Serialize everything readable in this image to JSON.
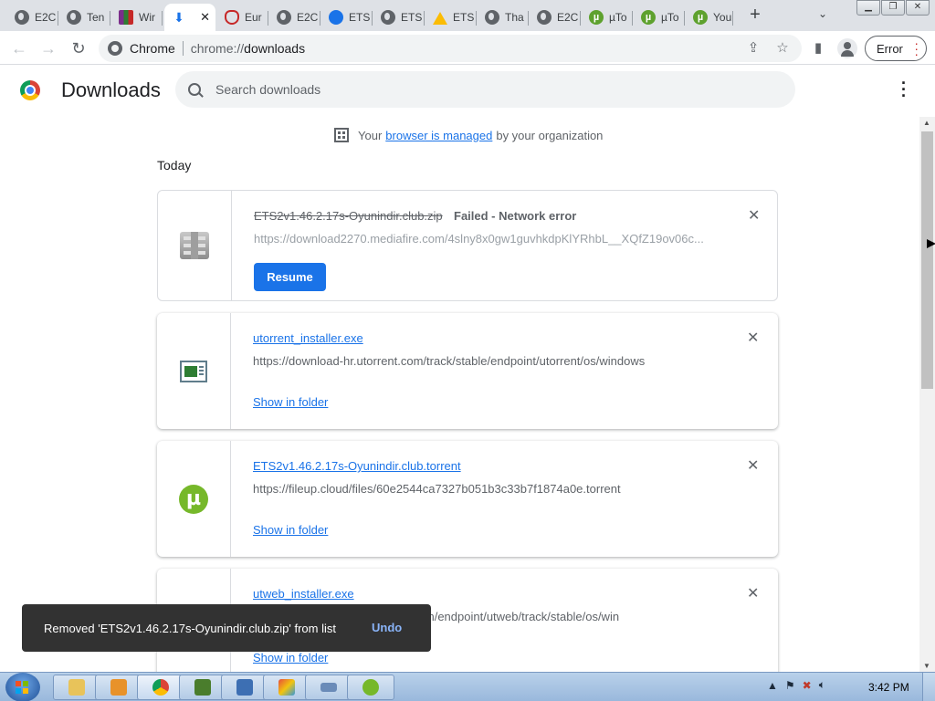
{
  "tabs": [
    {
      "title": "E2C",
      "icon": "globe-icon"
    },
    {
      "title": "Ten",
      "icon": "globe-icon"
    },
    {
      "title": "Wir",
      "icon": "winrar-icon"
    },
    {
      "title": "",
      "icon": "download-icon",
      "active": true
    },
    {
      "title": "Eur",
      "icon": "eur-icon"
    },
    {
      "title": "E2C",
      "icon": "globe-icon"
    },
    {
      "title": "ETS",
      "icon": "ets-icon"
    },
    {
      "title": "ETS",
      "icon": "globe-icon"
    },
    {
      "title": "ETS",
      "icon": "google-drive-icon"
    },
    {
      "title": "Tha",
      "icon": "globe-icon"
    },
    {
      "title": "E2C",
      "icon": "globe-icon"
    },
    {
      "title": "µTo",
      "icon": "utorrent-icon"
    },
    {
      "title": "µTo",
      "icon": "utorrent-icon"
    },
    {
      "title": "You",
      "icon": "utorrent-icon"
    }
  ],
  "toolbar": {
    "site_label": "Chrome",
    "url_scheme": "chrome://",
    "url_host": "downloads",
    "profile_button": "Error"
  },
  "header": {
    "title": "Downloads",
    "search_placeholder": "Search downloads"
  },
  "managed": {
    "prefix": "Your",
    "link": "browser is managed",
    "suffix": "by your organization"
  },
  "section": "Today",
  "downloads": [
    {
      "filename": "ETS2v1.46.2.17s-Oyunindir.club.zip",
      "status": "Failed - Network error",
      "url": "https://download2270.mediafire.com/4slny8x0gw1guvhkdpKlYRhbL__XQfZ19ov06c...",
      "action": "Resume",
      "icon": "winrar-archive-icon",
      "failed": true
    },
    {
      "filename": "utorrent_installer.exe",
      "url": "https://download-hr.utorrent.com/track/stable/endpoint/utorrent/os/windows",
      "action": "Show in folder",
      "icon": "exe-installer-icon"
    },
    {
      "filename": "ETS2v1.46.2.17s-Oyunindir.club.torrent",
      "url": "https://fileup.cloud/files/60e2544ca7327b051b3c33b7f1874a0e.torrent",
      "action": "Show in folder",
      "icon": "utorrent-icon"
    },
    {
      "filename": "utweb_installer.exe",
      "url": "https://download-new.utorrent.com/endpoint/utweb/track/stable/os/win",
      "action": "Show in folder",
      "icon": "exe-installer-icon"
    }
  ],
  "toast": {
    "message": "Removed 'ETS2v1.46.2.17s-Oyunindir.club.zip' from list",
    "undo": "Undo"
  },
  "taskbar": {
    "apps": [
      "file-explorer",
      "media-player",
      "chrome",
      "cpu-z",
      "yandex",
      "paint",
      "keyboard",
      "utorrent"
    ],
    "clock": "3:42 PM"
  }
}
